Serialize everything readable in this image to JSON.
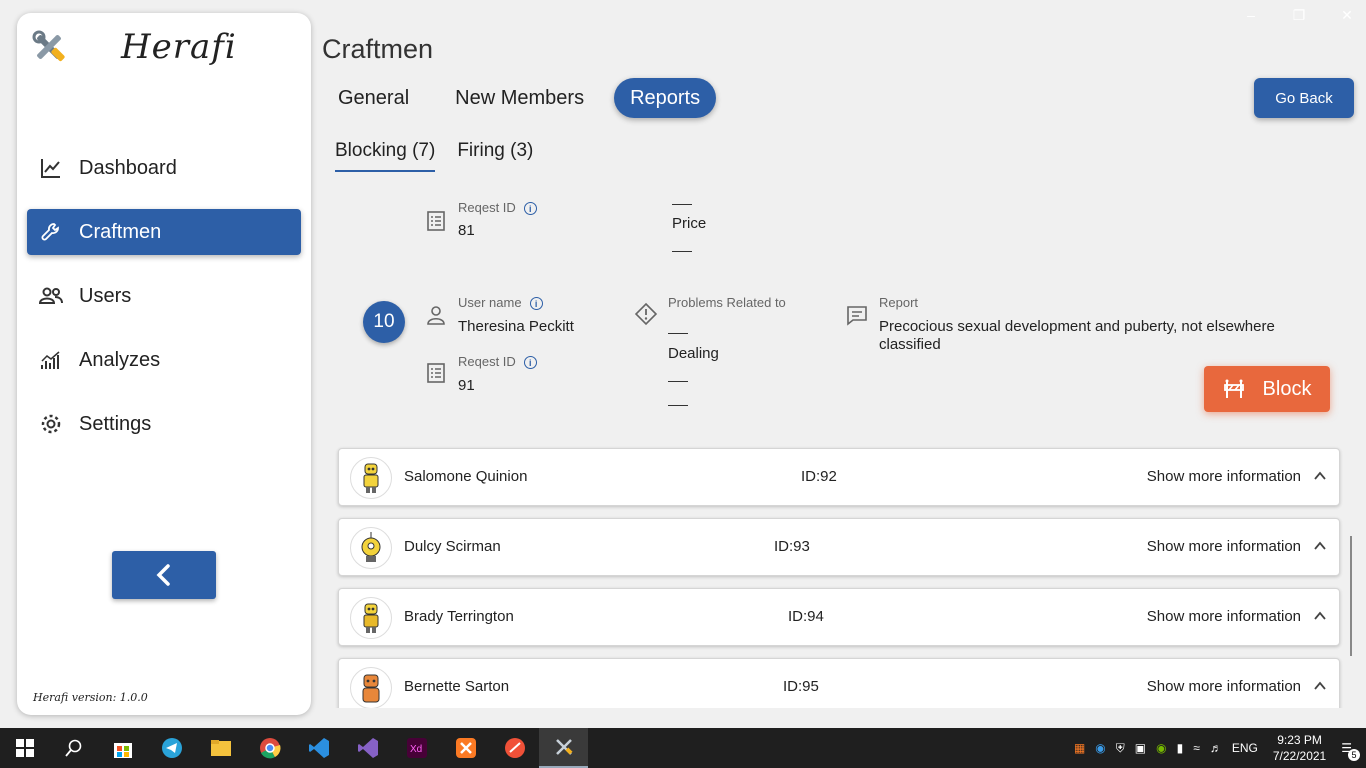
{
  "app": {
    "name": "Herafi",
    "version_text": "Herafi version: 1.0.0"
  },
  "sidebar": {
    "items": [
      {
        "label": "Dashboard",
        "icon": "chart-line-icon"
      },
      {
        "label": "Craftmen",
        "icon": "wrench-icon"
      },
      {
        "label": "Users",
        "icon": "users-icon"
      },
      {
        "label": "Analyzes",
        "icon": "analytics-icon"
      },
      {
        "label": "Settings",
        "icon": "gear-icon"
      }
    ],
    "active": "Craftmen"
  },
  "header": {
    "title": "Craftmen",
    "tabs": [
      "General",
      "New Members",
      "Reports"
    ],
    "active_tab": "Reports",
    "go_back": "Go Back"
  },
  "subtabs": [
    "Blocking (7)",
    "Firing (3)"
  ],
  "partial_report": {
    "request_id_label": "Reqest ID",
    "request_id": "81",
    "problem": "Price"
  },
  "report": {
    "number": "10",
    "user_name_label": "User name",
    "user_name": "Theresina Peckitt",
    "request_id_label": "Reqest ID",
    "request_id": "91",
    "problems_label": "Problems Related to",
    "problem": "Dealing",
    "report_label": "Report",
    "report_text": "Precocious sexual development and puberty, not elsewhere classified",
    "block_label": "Block"
  },
  "rows": [
    {
      "name": "Salomone Quinion",
      "id": "ID:92",
      "more": "Show more information"
    },
    {
      "name": "Dulcy Scirman",
      "id": "ID:93",
      "more": "Show more information"
    },
    {
      "name": "Brady Terrington",
      "id": "ID:94",
      "more": "Show more information"
    },
    {
      "name": "Bernette Sarton",
      "id": "ID:95",
      "more": "Show more information"
    }
  ],
  "taskbar": {
    "lang": "ENG",
    "time": "9:23 PM",
    "date": "7/22/2021",
    "notifications": "5"
  },
  "colors": {
    "primary": "#2d5fa7",
    "danger": "#e8683d",
    "background": "#f0f0f0"
  }
}
